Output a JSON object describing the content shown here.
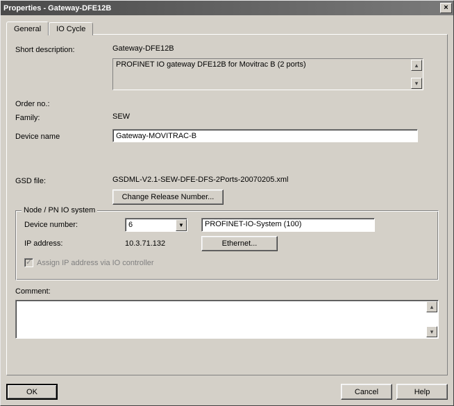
{
  "window": {
    "title": "Properties - Gateway-DFE12B",
    "close_label": "×"
  },
  "tabs": {
    "general": "General",
    "io_cycle": "IO Cycle"
  },
  "labels": {
    "short_description": "Short description:",
    "order_no": "Order no.:",
    "family": "Family:",
    "device_name": "Device name",
    "gsd_file": "GSD file:",
    "device_number": "Device number:",
    "ip_address": "IP address:",
    "assign_ip": "Assign IP address via IO controller",
    "comment": "Comment:",
    "node_group": "Node / PN IO system"
  },
  "values": {
    "short_desc_value": "Gateway-DFE12B",
    "short_desc_detail": "PROFINET IO gateway DFE12B for Movitrac B (2 ports)",
    "order_no": "",
    "family": "SEW",
    "device_name_value": "Gateway-MOVITRAC-B",
    "gsd_file": "GSDML-V2.1-SEW-DFE-DFS-2Ports-20070205.xml",
    "device_number": "6",
    "pn_io_system": "PROFINET-IO-System (100)",
    "ip_address": "10.3.71.132",
    "comment": ""
  },
  "buttons": {
    "change_release": "Change Release Number...",
    "ethernet": "Ethernet...",
    "ok": "OK",
    "cancel": "Cancel",
    "help": "Help"
  }
}
